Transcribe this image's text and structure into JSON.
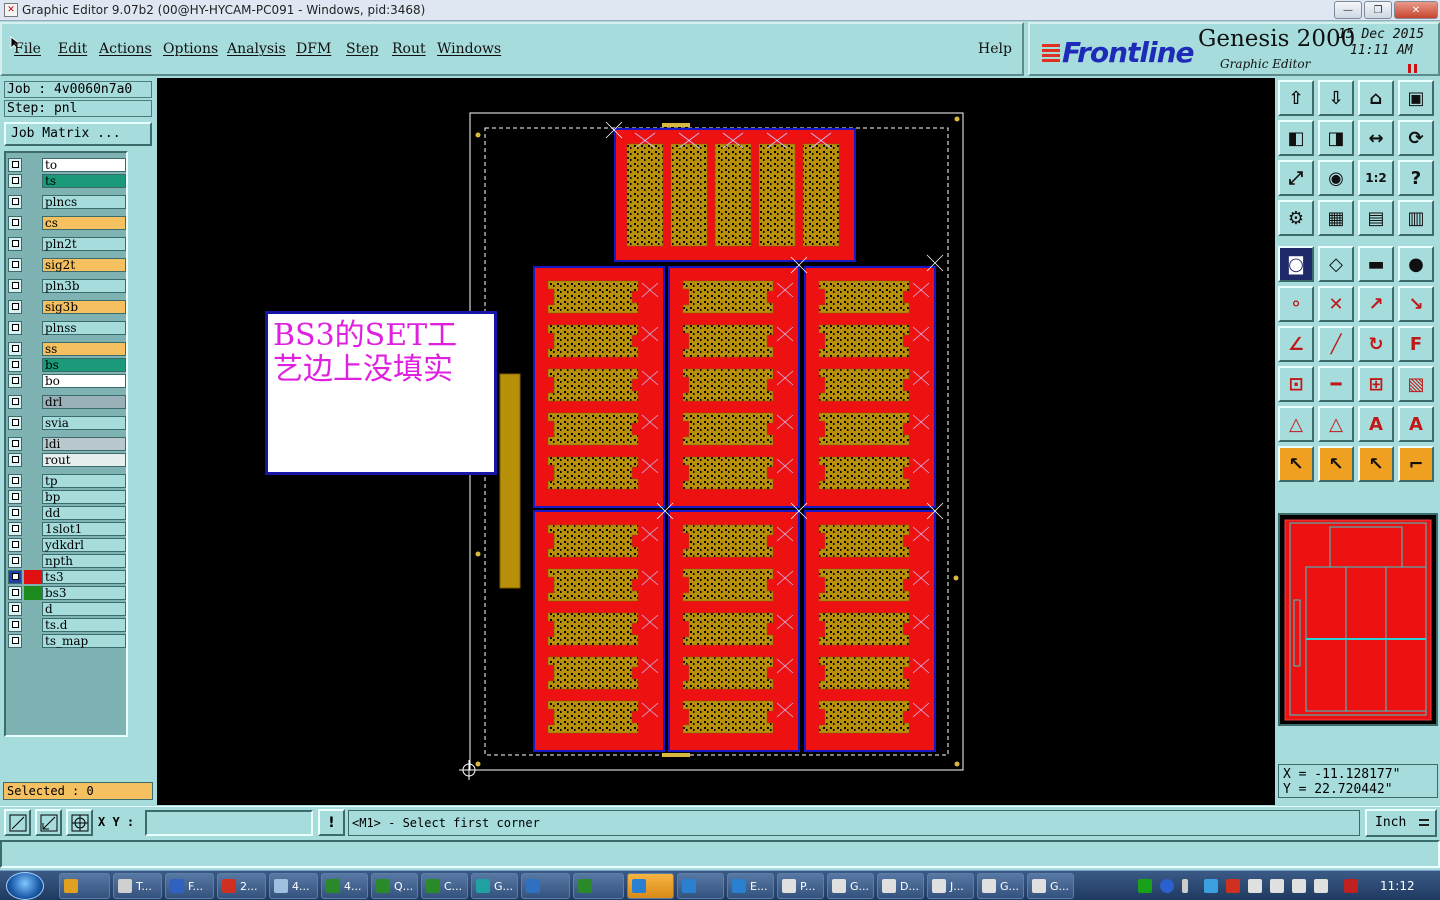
{
  "window": {
    "title": "Graphic Editor 9.07b2 (00@HY-HYCAM-PC091 - Windows, pid:3468)",
    "minimize_label": "—",
    "restore_label": "❐",
    "close_label": "✕"
  },
  "menu": {
    "items": [
      "File",
      "Edit",
      "Actions",
      "Options",
      "Analysis",
      "DFM",
      "Step",
      "Rout",
      "Windows"
    ],
    "help": "Help"
  },
  "brand": {
    "logo": "Frontline",
    "product": "Genesis 2000",
    "subtitle": "Graphic Editor",
    "date": "15 Dec 2015",
    "time": "11:11 AM"
  },
  "info": {
    "job": "Job : 4v0060n7a0",
    "step": "Step: pnl",
    "job_matrix": "Job Matrix ..."
  },
  "layers": [
    {
      "name": "to",
      "color": "#ffffff",
      "swatch": "#7fb3b3",
      "active": false
    },
    {
      "name": "ts",
      "color": "#1a9a78",
      "swatch": "#7fb3b3",
      "active": false
    },
    {
      "name": "plncs",
      "color": "#a6dcdc",
      "swatch": "#7fb3b3",
      "active": false
    },
    {
      "name": "cs",
      "color": "#f5c060",
      "swatch": "#7fb3b3",
      "active": false
    },
    {
      "name": "pln2t",
      "color": "#a6dcdc",
      "swatch": "#7fb3b3",
      "active": false
    },
    {
      "name": "sig2t",
      "color": "#f5c060",
      "swatch": "#7fb3b3",
      "active": false
    },
    {
      "name": "pln3b",
      "color": "#a6dcdc",
      "swatch": "#7fb3b3",
      "active": false
    },
    {
      "name": "sig3b",
      "color": "#f5c060",
      "swatch": "#7fb3b3",
      "active": false
    },
    {
      "name": "plnss",
      "color": "#a6dcdc",
      "swatch": "#7fb3b3",
      "active": false
    },
    {
      "name": "ss",
      "color": "#f5c060",
      "swatch": "#7fb3b3",
      "active": false
    },
    {
      "name": "bs",
      "color": "#1a9a78",
      "swatch": "#7fb3b3",
      "active": false
    },
    {
      "name": "bo",
      "color": "#ffffff",
      "swatch": "#7fb3b3",
      "active": false
    },
    {
      "name": "drl",
      "color": "#9ab0b8",
      "swatch": "#7fb3b3",
      "active": false
    },
    {
      "name": "svia",
      "color": "#a6dcdc",
      "swatch": "#7fb3b3",
      "active": false
    },
    {
      "name": "ldi",
      "color": "#b8c8cc",
      "swatch": "#7fb3b3",
      "active": false
    },
    {
      "name": "rout",
      "color": "#e6eeee",
      "swatch": "#7fb3b3",
      "active": false
    },
    {
      "name": "tp",
      "color": "#a6dcdc",
      "swatch": "#7fb3b3",
      "active": false
    },
    {
      "name": "bp",
      "color": "#a6dcdc",
      "swatch": "#7fb3b3",
      "active": false
    },
    {
      "name": "dd",
      "color": "#a6dcdc",
      "swatch": "#7fb3b3",
      "active": false
    },
    {
      "name": "1slot1",
      "color": "#a6dcdc",
      "swatch": "#7fb3b3",
      "active": false
    },
    {
      "name": "ydkdrl",
      "color": "#a6dcdc",
      "swatch": "#7fb3b3",
      "active": false
    },
    {
      "name": "npth",
      "color": "#a6dcdc",
      "swatch": "#7fb3b3",
      "active": false
    },
    {
      "name": "ts3",
      "color": "#a6dcdc",
      "swatch": "#e01010",
      "active": true
    },
    {
      "name": "bs3",
      "color": "#a6dcdc",
      "swatch": "#1c8a1c",
      "active": false
    },
    {
      "name": "d",
      "color": "#a6dcdc",
      "swatch": "#7fb3b3",
      "active": false
    },
    {
      "name": "ts.d",
      "color": "#a6dcdc",
      "swatch": "#7fb3b3",
      "active": false
    },
    {
      "name": "ts_map",
      "color": "#a6dcdc",
      "swatch": "#7fb3b3",
      "active": false
    }
  ],
  "selected": "Selected : 0",
  "annotation": {
    "line1": "BS3的SET工",
    "line2": "艺边上没填实"
  },
  "colors": {
    "background": "#000000",
    "copper_fill": "#ee1111",
    "board_outline": "#1818c8",
    "pattern": "#b8900a",
    "panel_frame": "#ffffff"
  },
  "toolbar_icons": [
    "step-up-icon",
    "step-down-icon",
    "home-icon",
    "window-split-icon",
    "pan-left-icon",
    "pan-right-icon",
    "mirror-icon",
    "snap-icon",
    "zoom-fit-icon",
    "zoom-center-icon",
    "zoom-1to2-icon",
    "help-icon",
    "tools-icon",
    "grid-icon",
    "layers-view-icon",
    "layers-compare-icon",
    "fill-outline-icon",
    "edit-shape-icon",
    "ruler-icon",
    "pad-icon",
    "node-connect-icon",
    "cross-icon",
    "line-node-icon",
    "point-move-icon",
    "angle-icon",
    "line-draw-icon",
    "arc-rotate-icon",
    "flip-f-icon",
    "point-snap-icon",
    "minus-line-icon",
    "measure-box-icon",
    "layer-copy-icon",
    "triangle-warning-icon",
    "triangle-arrow-icon",
    "triangle-up-icon",
    "triangle-right-icon",
    "select-arrow-icon",
    "select-box-icon",
    "select-circle-icon",
    "select-poly-icon"
  ],
  "coords": {
    "x": "X = -11.128177\"",
    "y": "Y = 22.720442\""
  },
  "bottom": {
    "xy_label": "X Y :",
    "xy_value": "",
    "warning": "!",
    "prompt": "<M1> - Select first corner",
    "units": "Inch"
  },
  "taskbar": {
    "items": [
      "",
      "T...",
      "F...",
      "2...",
      "4...",
      "4...",
      "Q...",
      "C...",
      "G...",
      "",
      "",
      "",
      "",
      "E...",
      "P...",
      "G...",
      "D...",
      "J...",
      "G...",
      "G..."
    ],
    "clock": "11:12"
  }
}
